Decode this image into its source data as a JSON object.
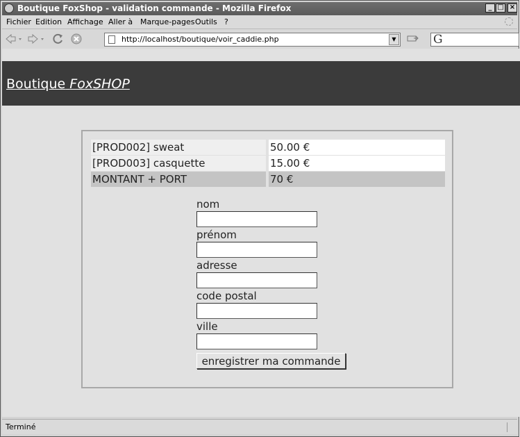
{
  "window": {
    "title": "Boutique FoxShop - validation commande - Mozilla Firefox"
  },
  "window_controls": {
    "minimize": "_",
    "maximize": "□",
    "close": "×"
  },
  "menu": [
    "Fichier",
    "Edition",
    "Affichage",
    "Aller à",
    "Marque-pages",
    "Outils",
    "?"
  ],
  "toolbar": {
    "back_icon": "back-arrow-icon",
    "forward_icon": "forward-arrow-icon",
    "reload_icon": "reload-icon",
    "stop_icon": "stop-icon",
    "url": "http://localhost/boutique/voir_caddie.php",
    "search_glyph": "G"
  },
  "site": {
    "brand_prefix": "Boutique",
    "brand_name": "FoxSHOP"
  },
  "cart": {
    "rows": [
      {
        "label": "[PROD002] sweat",
        "price": "50.00 €"
      },
      {
        "label": "[PROD003] casquette",
        "price": "15.00 €"
      }
    ],
    "total": {
      "label": "MONTANT + PORT",
      "value": "70 €"
    }
  },
  "form": {
    "fields": [
      {
        "label": "nom",
        "value": ""
      },
      {
        "label": "prénom",
        "value": ""
      },
      {
        "label": "adresse",
        "value": ""
      },
      {
        "label": "code postal",
        "value": ""
      },
      {
        "label": "ville",
        "value": ""
      }
    ],
    "submit_label": "enregistrer ma commande"
  },
  "status": {
    "text": "Terminé"
  },
  "colors": {
    "titlebar": "#5a5a5a",
    "header": "#3b3b3b",
    "page_bg": "#e1e1e1",
    "total_row": "#c4c4c4"
  }
}
